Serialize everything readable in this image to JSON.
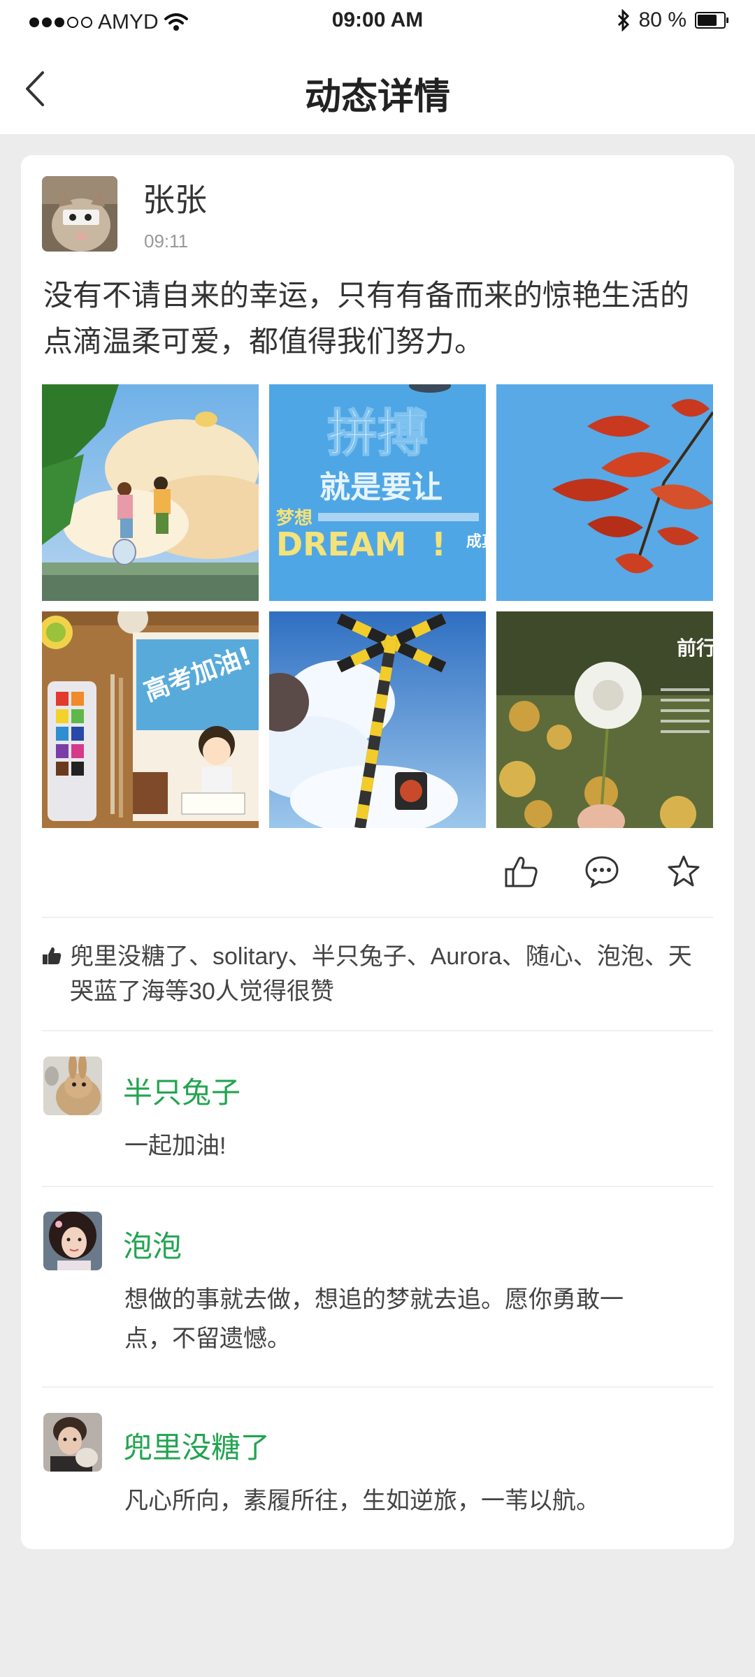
{
  "status_bar": {
    "carrier": "AMYD",
    "time": "09:00 AM",
    "battery": "80 %",
    "battery_level": 0.8,
    "icons": [
      "signal-dots-icon",
      "wifi-icon",
      "bluetooth-icon",
      "battery-icon"
    ]
  },
  "nav": {
    "title": "动态详情",
    "back_icon": "chevron-left-icon"
  },
  "post": {
    "author": "张张",
    "time": "09:11",
    "text": "没有不请自来的幸运，只有有备而来的惊艳生活的点滴温柔可爱，都值得我们努力。",
    "images": [
      {
        "name": "anime-sky-jump",
        "texts": []
      },
      {
        "name": "dream-poster",
        "texts": [
          "拼搏",
          "就是要让",
          "梦想",
          "DREAM",
          "!",
          "成真"
        ]
      },
      {
        "name": "red-leaves",
        "texts": []
      },
      {
        "name": "watercolor-study",
        "texts": [
          "高考加油!"
        ]
      },
      {
        "name": "railway-crossing",
        "texts": []
      },
      {
        "name": "dandelion",
        "texts": [
          "前行"
        ]
      }
    ]
  },
  "actions": {
    "like_icon": "thumbs-up-icon",
    "comment_icon": "comment-bubble-icon",
    "favorite_icon": "star-icon"
  },
  "likes": {
    "icon": "thumbs-up-small-icon",
    "text": "兜里没糖了、solitary、半只兔子、Aurora、随心、泡泡、天哭蓝了海等30人觉得很赞"
  },
  "comments": [
    {
      "name": "半只兔子",
      "text": "一起加油!"
    },
    {
      "name": "泡泡",
      "text": "想做的事就去做，想追的梦就去追。愿你勇敢一点，不留遗憾。"
    },
    {
      "name": "兜里没糖了",
      "text": "凡心所向，素履所往，生如逆旅，一苇以航。"
    }
  ],
  "colors": {
    "accent_green": "#23a451",
    "background": "#ececec",
    "card": "#ffffff"
  }
}
